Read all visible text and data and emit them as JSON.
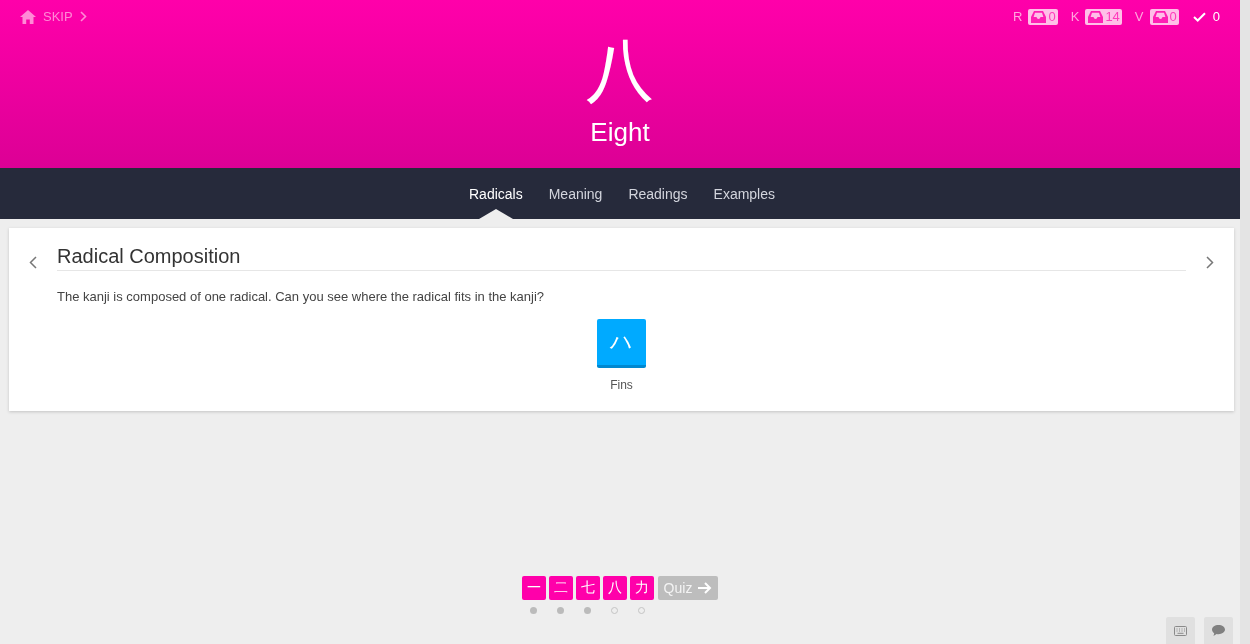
{
  "header": {
    "skip_label": "SKIP",
    "kanji": "八",
    "meaning": "Eight",
    "counters": [
      {
        "kind": "queue",
        "label": "R",
        "count": "0"
      },
      {
        "kind": "queue",
        "label": "K",
        "count": "14"
      },
      {
        "kind": "queue",
        "label": "V",
        "count": "0"
      },
      {
        "kind": "done",
        "count": "0"
      }
    ]
  },
  "tabs": [
    {
      "label": "Radicals",
      "selected": true
    },
    {
      "label": "Meaning",
      "selected": false
    },
    {
      "label": "Readings",
      "selected": false
    },
    {
      "label": "Examples",
      "selected": false
    }
  ],
  "card": {
    "title": "Radical Composition",
    "text": "The kanji is composed of one radical. Can you see where the radical fits in the kanji?",
    "radicals": [
      {
        "character": "ハ",
        "name": "Fins"
      }
    ]
  },
  "lesson_queue": {
    "items": [
      {
        "character": "一",
        "viewed": true
      },
      {
        "character": "二",
        "viewed": true
      },
      {
        "character": "七",
        "viewed": true
      },
      {
        "character": "八",
        "viewed": false
      },
      {
        "character": "力",
        "viewed": false
      }
    ],
    "quiz": {
      "label": "Quiz",
      "disabled": true
    }
  }
}
